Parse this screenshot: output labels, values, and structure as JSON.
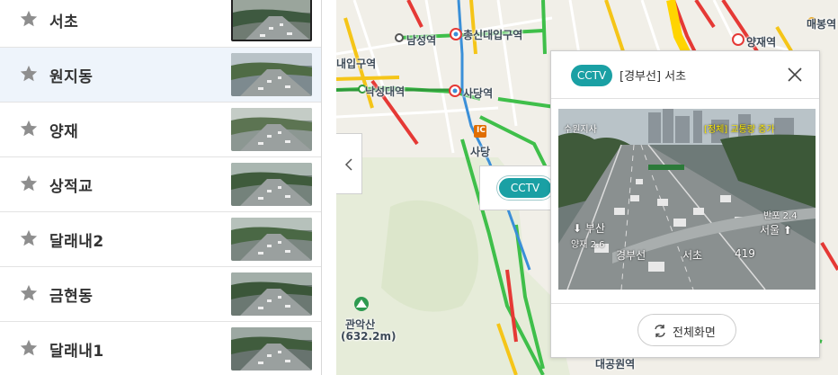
{
  "cctv_list": [
    {
      "name": "서초"
    },
    {
      "name": "원지동"
    },
    {
      "name": "양재"
    },
    {
      "name": "상적교"
    },
    {
      "name": "달래내2"
    },
    {
      "name": "금현동"
    },
    {
      "name": "달래내1"
    }
  ],
  "map": {
    "labels": {
      "namseong": "남성역",
      "chongsin": "총신대입구역",
      "naebang_partial": "내입구역",
      "naksungdae": "낙성대역",
      "sadang_station": "사당역",
      "sadang": "사당",
      "yangjae": "양재역",
      "maeheon": "매봉역",
      "gwanaksan": "관악산",
      "gwanaksan_elev": "(632.2m)",
      "daecheong": "대공원역"
    },
    "pin_label": "CCTV",
    "ic_label": "IC"
  },
  "popup": {
    "badge": "CCTV",
    "title": "[경부선] 서초",
    "full_screen": "전체화면",
    "cam_overlay": {
      "corner": "수원지사",
      "alert": "[정체] 교통량 증가",
      "busan": "부산",
      "yangjae_dist": "양재 2.6",
      "seoul": "서울",
      "banpo_dist": "반포 2.4",
      "road": "경부선",
      "place": "서초",
      "code": "419"
    }
  },
  "colors": {
    "accent": "#1aa0a4",
    "selected_row": "#eef4fb",
    "traffic_green": "#3fbf4a",
    "traffic_yellow": "#f5c518",
    "traffic_red": "#e53935"
  }
}
